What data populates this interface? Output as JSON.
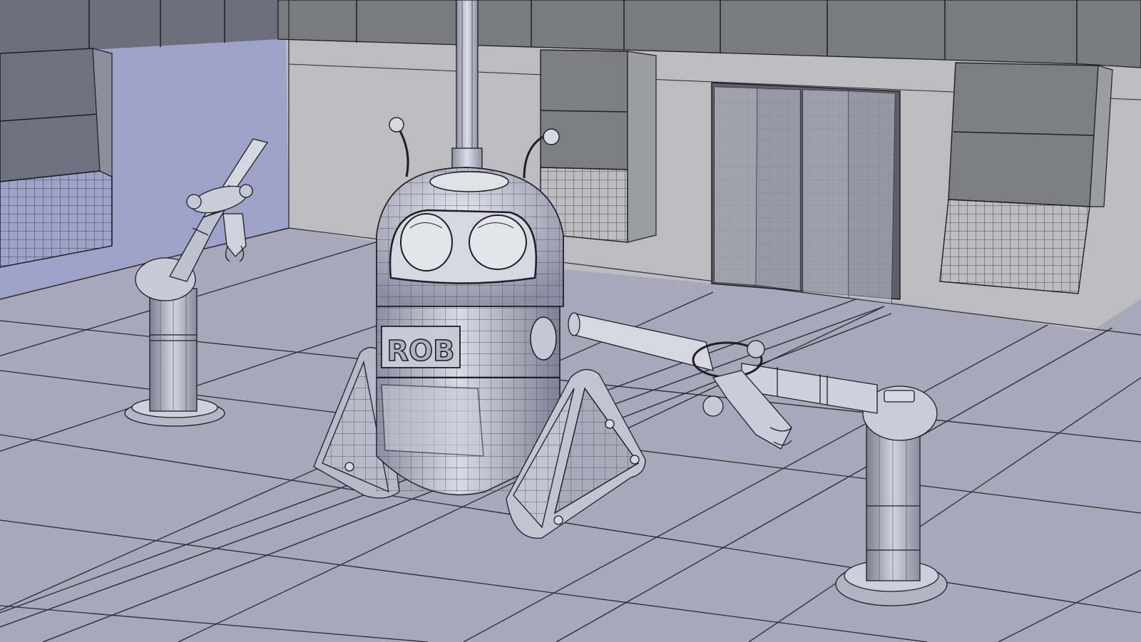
{
  "scene": {
    "robot_label": "ROB",
    "colors": {
      "floor": "#a7a8ba",
      "floor_line": "#2a2a33",
      "wall_left": "#9fa3c7",
      "wall_back": "#bdbdbf",
      "panel": "#7e7f85",
      "panel_dark": "#5f6068",
      "grille": "#6c6d78",
      "metal_light": "#d7d8e2",
      "metal_mid": "#a9aabb",
      "metal_dark": "#6e6f80",
      "wire": "#1e1e24"
    }
  }
}
